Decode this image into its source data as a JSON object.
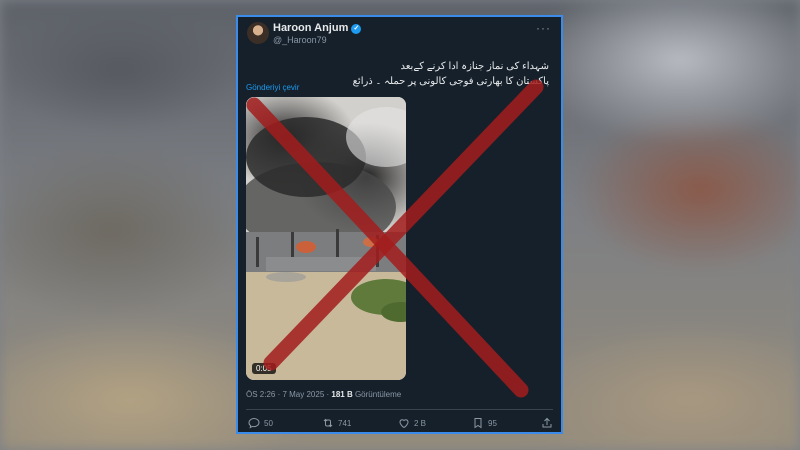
{
  "tweet": {
    "author_name": "Haroon Anjum",
    "handle": "@_Haroon79",
    "text_lines": [
      "شہداء کی نماز جنازہ ادا کرنے کےبعد",
      "پاکستان کا بھارتی فوجی کالونی پر حملہ ۔ ذرائع"
    ],
    "translate_label": "Gönderiyi çevir",
    "video_duration": "0:05",
    "timestamp": "ÖS 2:26 · 7 May 2025 · ",
    "views_count": "181 B",
    "views_label": " Görüntüleme",
    "replies": "50",
    "retweets": "741",
    "likes": "2 B",
    "bookmarks": "95"
  },
  "icons": [
    "verified-badge-icon",
    "more-options-icon",
    "reply-icon",
    "retweet-icon",
    "like-icon",
    "bookmark-icon",
    "share-icon"
  ],
  "colors": {
    "card_bg": "#15202b",
    "card_border": "#3a8bea",
    "link": "#1d9bf0",
    "cross": "#a31d1d"
  }
}
